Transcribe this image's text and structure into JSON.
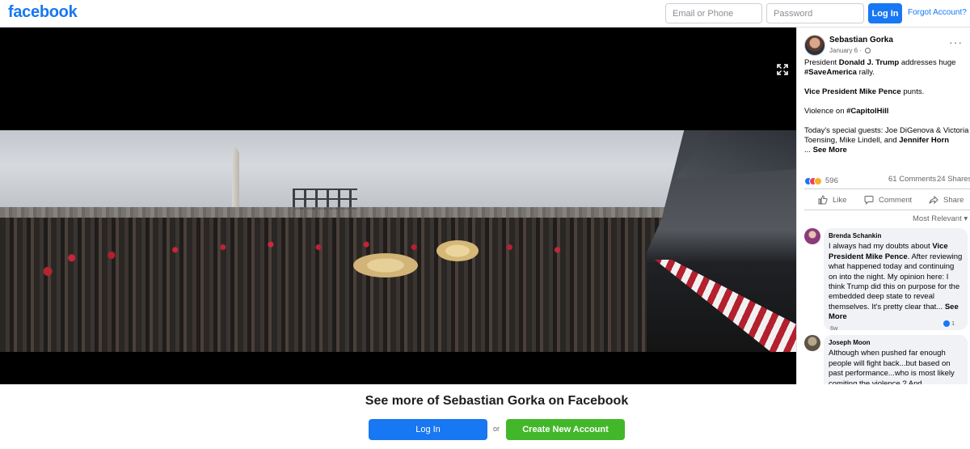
{
  "header": {
    "logo": "facebook",
    "email_placeholder": "Email or Phone",
    "password_placeholder": "Password",
    "login_label": "Log In",
    "forgot_label": "Forgot Account?"
  },
  "post": {
    "author": "Sebastian Gorka",
    "date": "January 6 · ",
    "text": {
      "p1_a": "President ",
      "p1_b": "Donald J. Trump",
      "p1_c": " addresses huge ",
      "p1_d": "#SaveAmerica",
      "p1_e": " rally.",
      "p2_a": "Vice President Mike Pence",
      "p2_b": " punts.",
      "p3_a": "Violence on ",
      "p3_b": "#CapitolHill",
      "p4_a": "Today's special guests: Joe DiGenova & Victoria Toensing, Mike Lindell, and ",
      "p4_b": "Jennifer Horn",
      "p4_c": "... ",
      "see_more": "See More"
    },
    "reaction_count": "596",
    "comments_count": "61 Comments",
    "shares_count": "24 Shares",
    "actions": {
      "like": "Like",
      "comment": "Comment",
      "share": "Share"
    },
    "sort_label": "Most Relevant ▾"
  },
  "comments": [
    {
      "name": "Brenda Schankin",
      "text_a": "I always had my doubts about ",
      "text_b": "Vice President Mike Pence",
      "text_c": ". After reviewing what happened today and continuing on into the night. My opinion here: I think Trump did this on purpose for the embedded deep state to reveal themselves. It's pretty clear that... ",
      "see_more": "See More",
      "age": "6w",
      "likes": "1"
    },
    {
      "name": "Joseph Moon",
      "text": "Although when pushed far enough people will fight back...but based on past performance...who is most likely comiting the violence ? And"
    }
  ],
  "bottom": {
    "title": "See more of Sebastian Gorka on Facebook",
    "login_label": "Log In",
    "or_label": "or",
    "create_label": "Create New Account"
  },
  "colors": {
    "brand": "#1877f2",
    "create": "#42b72a"
  }
}
